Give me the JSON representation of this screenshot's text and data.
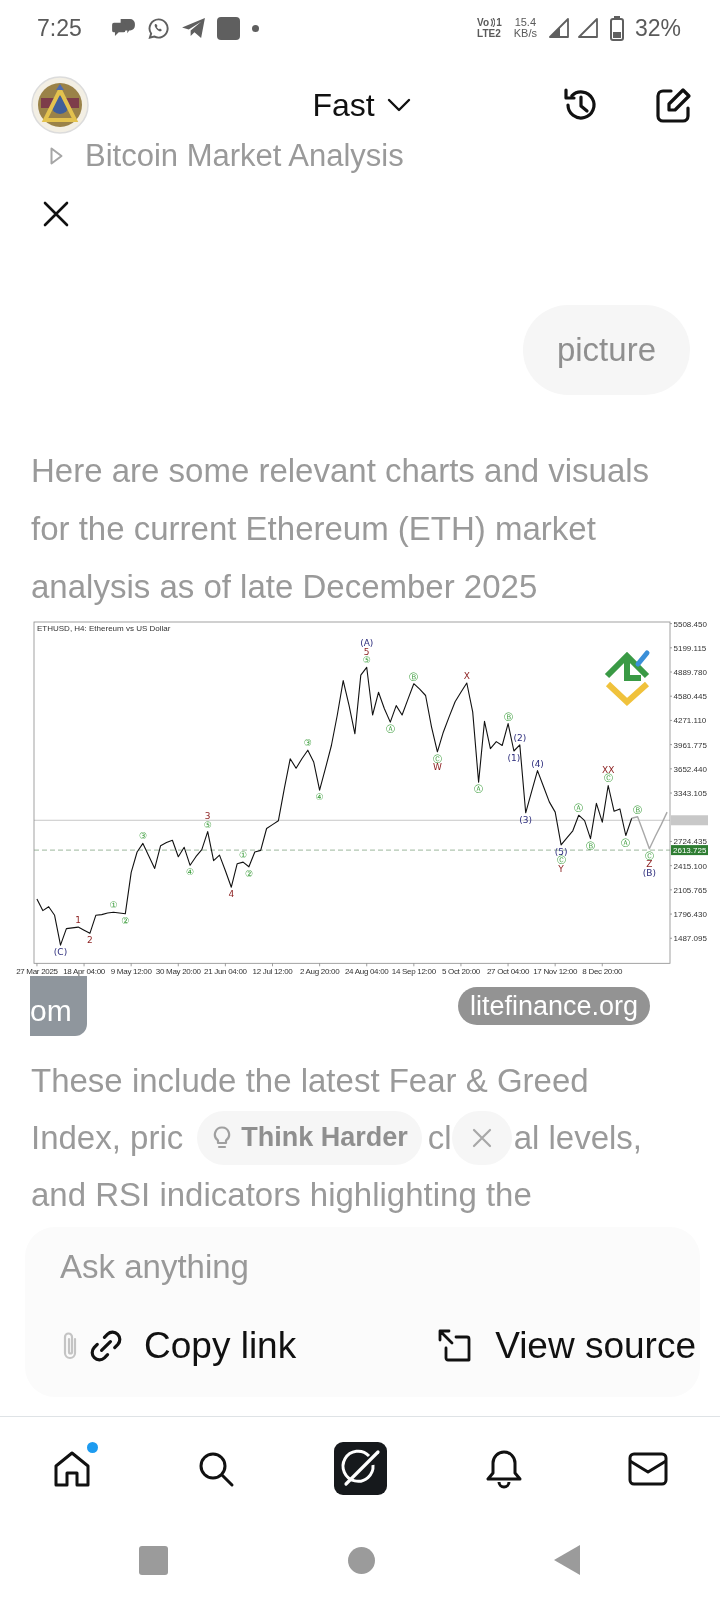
{
  "status_bar": {
    "time": "7:25",
    "volte_top": "Vo",
    "volte_sim": "1",
    "volte_bottom": "LTE2",
    "speed_value": "15.4",
    "speed_unit": "KB/s",
    "battery": "32%"
  },
  "header": {
    "title": "Fast"
  },
  "topic": {
    "title": "Bitcoin Market Analysis"
  },
  "user_message": {
    "text": "picture"
  },
  "response": {
    "paragraph": "Here are some relevant charts and visuals for the current Ethereum (ETH) market analysis as of late December 2025",
    "chart_data": {
      "type": "line",
      "title": "ETHUSD, H4:  Ethereum vs US Dollar",
      "categories": [
        "27 Mar 2025",
        null,
        null,
        null,
        null,
        null,
        null,
        null,
        "18 Apr 04:00",
        null,
        null,
        null,
        null,
        null,
        null,
        null,
        "9 May 12:00",
        null,
        null,
        null,
        null,
        null,
        null,
        null,
        "30 May 20:00",
        null,
        null,
        null,
        null,
        null,
        null,
        null,
        "21 Jun 04:00",
        null,
        null,
        null,
        null,
        null,
        null,
        null,
        "12 Jul 12:00",
        null,
        null,
        null,
        null,
        null,
        null,
        null,
        "2 Aug 20:00",
        null,
        null,
        null,
        null,
        null,
        null,
        null,
        "24 Aug 04:00",
        null,
        null,
        null,
        null,
        null,
        null,
        null,
        "14 Sep 12:00",
        null,
        null,
        null,
        null,
        null,
        null,
        null,
        "5 Oct 20:00",
        null,
        null,
        null,
        null,
        null,
        null,
        null,
        "27 Oct 04:00",
        null,
        null,
        null,
        null,
        null,
        null,
        null,
        "17 Nov 12:00",
        null,
        null,
        null,
        null,
        null,
        null,
        null,
        "8 Dec 20:00",
        null,
        null,
        null,
        null,
        null,
        null,
        null,
        null,
        null,
        null,
        null
      ],
      "series": [
        {
          "color": "#111111",
          "values": [
            1990,
            1840,
            1890,
            1780,
            1400,
            1610,
            1620,
            1630,
            1590,
            1550,
            1780,
            1790,
            1810,
            1820,
            1810,
            1800,
            2330,
            2590,
            2700,
            2540,
            2380,
            2670,
            2710,
            2740,
            2530,
            2650,
            2420,
            2530,
            2620,
            2850,
            2480,
            2550,
            2350,
            2140,
            2440,
            2460,
            2400,
            2590,
            2610,
            2890,
            2940,
            2990,
            3400,
            3780,
            3660,
            3780,
            3890,
            3740,
            3380,
            3660,
            3950,
            4340,
            4780,
            4460,
            4100,
            4850,
            4950,
            4340,
            4630,
            4420,
            4250,
            4460,
            4340,
            4540,
            4740,
            4670,
            4590,
            4190,
            3870,
            4120,
            4320,
            4510,
            4630,
            4750,
            4380,
            3480,
            4260,
            3910,
            4000,
            3950,
            4230,
            3880,
            3960,
            3090,
            3360,
            3630,
            3430,
            3230,
            3100,
            2680,
            2770,
            2860,
            3060,
            2990,
            2760,
            3210,
            2970,
            3440,
            3110,
            3140,
            2800,
            3020,
            null,
            null,
            null,
            null,
            null,
            null
          ]
        },
        {
          "color": "#a8a8a8",
          "values": [
            null,
            null,
            null,
            null,
            null,
            null,
            null,
            null,
            null,
            null,
            null,
            null,
            null,
            null,
            null,
            null,
            null,
            null,
            null,
            null,
            null,
            null,
            null,
            null,
            null,
            null,
            null,
            null,
            null,
            null,
            null,
            null,
            null,
            null,
            null,
            null,
            null,
            null,
            null,
            null,
            null,
            null,
            null,
            null,
            null,
            null,
            null,
            null,
            null,
            null,
            null,
            null,
            null,
            null,
            null,
            null,
            null,
            null,
            null,
            null,
            null,
            null,
            null,
            null,
            null,
            null,
            null,
            null,
            null,
            null,
            null,
            null,
            null,
            null,
            null,
            null,
            null,
            null,
            null,
            null,
            null,
            null,
            null,
            null,
            null,
            null,
            null,
            null,
            null,
            null,
            null,
            null,
            null,
            null,
            null,
            null,
            null,
            null,
            null,
            null,
            null,
            3020,
            3040,
            2840,
            2630,
            2790,
            2940,
            3100
          ]
        }
      ],
      "ylim": [
        1167,
        5529
      ],
      "yticks": [
        {
          "value": 5508.45,
          "label": "5508.450"
        },
        {
          "value": 5199.115,
          "label": "5199.115"
        },
        {
          "value": 4889.78,
          "label": "4889.780"
        },
        {
          "value": 4580.445,
          "label": "4580.445"
        },
        {
          "value": 4271.11,
          "label": "4271.110"
        },
        {
          "value": 3961.775,
          "label": "3961.775"
        },
        {
          "value": 3652.44,
          "label": "3652.440"
        },
        {
          "value": 3343.105,
          "label": "3343.105"
        },
        {
          "value": 2724.435,
          "label": "2724.435"
        },
        {
          "value": 2415.1,
          "label": "2415.100"
        },
        {
          "value": 2105.765,
          "label": "2105.765"
        },
        {
          "value": 1796.43,
          "label": "1796.430"
        },
        {
          "value": 1487.095,
          "label": "1487.095"
        }
      ],
      "ref_lines": [
        {
          "axis": "y",
          "value": 2995
        },
        {
          "axis": "y",
          "value": 2613.725,
          "label": "2613.725"
        }
      ],
      "annotations": [
        {
          "text": "(C)",
          "y": 1400
        },
        {
          "text": "1",
          "y": 1630
        },
        {
          "text": "2",
          "y": 1550
        },
        {
          "text": "①",
          "y": 1820
        },
        {
          "text": "②",
          "y": 1800
        },
        {
          "text": "③",
          "y": 2700
        },
        {
          "text": "④",
          "y": 2420
        },
        {
          "text": "3",
          "y": 2850
        },
        {
          "text": "⑤",
          "y": 2850
        },
        {
          "text": "4",
          "y": 2140
        },
        {
          "text": "①",
          "y": 2460
        },
        {
          "text": "②",
          "y": 2400
        },
        {
          "text": "③",
          "y": 3890
        },
        {
          "text": "④",
          "y": 3380
        },
        {
          "text": "(A)",
          "y": 4950
        },
        {
          "text": "5",
          "y": 4950
        },
        {
          "text": "⑤",
          "y": 4950
        },
        {
          "text": "Ⓐ",
          "y": 4250
        },
        {
          "text": "Ⓑ",
          "y": 4740
        },
        {
          "text": "Ⓒ",
          "y": 3870
        },
        {
          "text": "W",
          "y": 3870
        },
        {
          "text": "X",
          "y": 4750
        },
        {
          "text": "Ⓐ",
          "y": 3480
        },
        {
          "text": "Ⓑ",
          "y": 4230
        },
        {
          "text": "(2)",
          "y": 3960
        },
        {
          "text": "(1)",
          "y": 3880
        },
        {
          "text": "(3)",
          "y": 3090
        },
        {
          "text": "(4)",
          "y": 3630
        },
        {
          "text": "(5)",
          "y": 2680
        },
        {
          "text": "Ⓒ",
          "y": 2680
        },
        {
          "text": "Y",
          "y": 2680
        },
        {
          "text": "Ⓐ",
          "y": 3060
        },
        {
          "text": "Ⓑ",
          "y": 2760
        },
        {
          "text": "XX",
          "y": 3440
        },
        {
          "text": "Ⓒ",
          "y": 3440
        },
        {
          "text": "Ⓐ",
          "y": 2800
        },
        {
          "text": "Ⓑ",
          "y": 3040
        },
        {
          "text": "Ⓒ",
          "y": 2630
        },
        {
          "text": "Z",
          "y": 2630
        },
        {
          "text": "(B)",
          "y": 2630
        }
      ]
    },
    "source_thumbnail": {
      "text": "om"
    },
    "source_link": {
      "label": "litefinance.org"
    },
    "paragraph_2": {
      "line_1": "These include the latest Fear & Greed",
      "line_2_start": "Index, pric",
      "line_2_middle": "cl",
      "line_2_end": "al levels,",
      "line_3": "and RSI indicators highlighting the"
    }
  },
  "think_harder_chip": {
    "label": "Think Harder"
  },
  "composer": {
    "placeholder": "Ask anything"
  },
  "image_actions": [
    {
      "kind": "copy",
      "label": "Copy link"
    },
    {
      "kind": "source",
      "label": "View source"
    }
  ],
  "bottom_nav": [
    {
      "kind": "home",
      "badge": true
    },
    {
      "kind": "search",
      "badge": false
    },
    {
      "kind": "app",
      "badge": false
    },
    {
      "kind": "notifications",
      "badge": false
    },
    {
      "kind": "messages",
      "badge": false
    }
  ]
}
